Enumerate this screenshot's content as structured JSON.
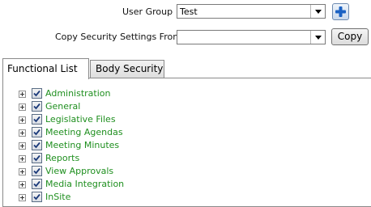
{
  "user_group": {
    "label": "User Group",
    "value": "Test",
    "add_icon": "plus-icon"
  },
  "copy_security": {
    "label": "Copy Security Settings From",
    "value": "",
    "button_label": "Copy"
  },
  "tabs": [
    {
      "label": "Functional List",
      "active": true
    },
    {
      "label": "Body Security",
      "active": false
    }
  ],
  "tree": {
    "label_color": "#1f8f1f",
    "items": [
      {
        "label": "Administration",
        "checked": true
      },
      {
        "label": "General",
        "checked": true
      },
      {
        "label": "Legislative Files",
        "checked": true
      },
      {
        "label": "Meeting Agendas",
        "checked": true
      },
      {
        "label": "Meeting Minutes",
        "checked": true
      },
      {
        "label": "Reports",
        "checked": true
      },
      {
        "label": "View Approvals",
        "checked": true
      },
      {
        "label": "Media Integration",
        "checked": true
      },
      {
        "label": "InSite",
        "checked": true
      }
    ]
  }
}
